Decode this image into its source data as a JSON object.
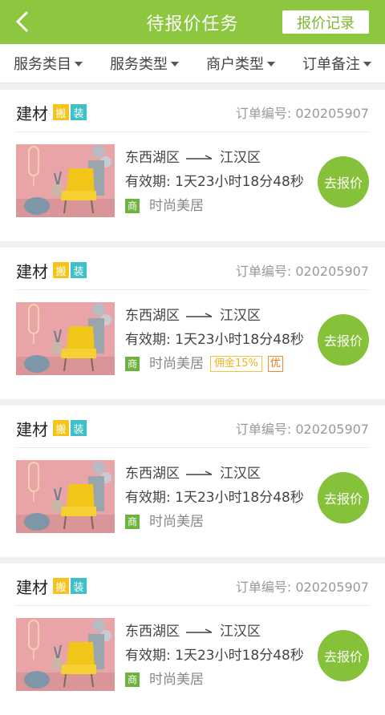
{
  "header": {
    "title": "待报价任务",
    "record_label": "报价记录"
  },
  "filters": [
    {
      "label": "服务类目"
    },
    {
      "label": "服务类型"
    },
    {
      "label": "商户类型"
    },
    {
      "label": "订单备注"
    }
  ],
  "orders": [
    {
      "category": "建材",
      "tag1": "搬",
      "tag2": "装",
      "order_no": "订单编号: 020205907",
      "from": "东西湖区",
      "to": "江汉区",
      "validity": "有效期: 1天23小时18分48秒",
      "shop_badge": "商",
      "shop": "时尚美居",
      "quote_label": "去报价"
    },
    {
      "category": "建材",
      "tag1": "搬",
      "tag2": "装",
      "order_no": "订单编号: 020205907",
      "from": "东西湖区",
      "to": "江汉区",
      "validity": "有效期: 1天23小时18分48秒",
      "shop_badge": "商",
      "shop": "时尚美居",
      "commission": "佣金15%",
      "you": "优",
      "quote_label": "去报价"
    },
    {
      "category": "建材",
      "tag1": "搬",
      "tag2": "装",
      "order_no": "订单编号: 020205907",
      "from": "东西湖区",
      "to": "江汉区",
      "validity": "有效期: 1天23小时18分48秒",
      "shop_badge": "商",
      "shop": "时尚美居",
      "quote_label": "去报价"
    },
    {
      "category": "建材",
      "tag1": "搬",
      "tag2": "装",
      "order_no": "订单编号: 020205907",
      "from": "东西湖区",
      "to": "江汉区",
      "validity": "有效期: 1天23小时18分48秒",
      "shop_badge": "商",
      "shop": "时尚美居",
      "quote_label": "去报价"
    }
  ],
  "colors": {
    "brand": "#8dc63f",
    "tag_ban": "#f5c319",
    "tag_zhuang": "#3ec0c6",
    "commission": "#f0b320",
    "you": "#ee7a1c"
  }
}
